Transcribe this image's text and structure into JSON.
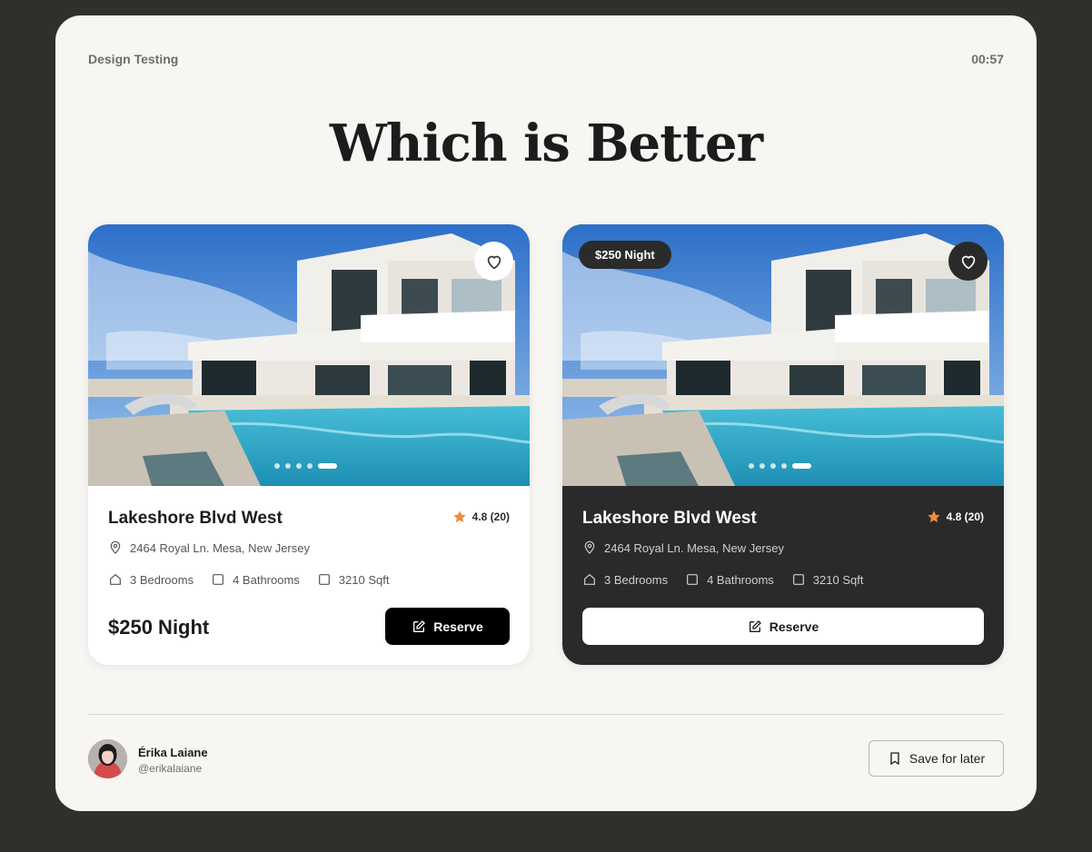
{
  "header": {
    "app_label": "Design Testing",
    "timer": "00:57"
  },
  "title": "Which is Better",
  "cards": [
    {
      "variant": "light",
      "name": "Lakeshore Blvd West",
      "rating": "4.8 (20)",
      "address": "2464 Royal Ln. Mesa, New Jersey",
      "features": [
        "3 Bedrooms",
        "4 Bathrooms",
        "3210 Sqft"
      ],
      "price": "$250 Night",
      "reserve_label": "Reserve",
      "carousel": {
        "count": 5,
        "active": 4
      }
    },
    {
      "variant": "dark",
      "name": "Lakeshore Blvd West",
      "rating": "4.8 (20)",
      "address": "2464 Royal Ln. Mesa, New Jersey",
      "features": [
        "3 Bedrooms",
        "4 Bathrooms",
        "3210 Sqft"
      ],
      "price_pill": "$250 Night",
      "reserve_label": "Reserve",
      "carousel": {
        "count": 5,
        "active": 4
      }
    }
  ],
  "footer": {
    "user_name": "Érika Laiane",
    "user_handle": "@erikalaiane",
    "save_label": "Save for later"
  },
  "icons": {
    "favorite": "heart-icon",
    "rating": "star-icon",
    "address": "location-pin-icon",
    "bedrooms": "house-icon",
    "bathrooms": "square-icon",
    "area": "square-icon",
    "reserve": "edit-icon",
    "save": "bookmark-icon"
  },
  "colors": {
    "background": "#302f2b",
    "panel": "#f7f6f3",
    "star": "#f08a3c",
    "dark_card": "#2a2a2a"
  }
}
